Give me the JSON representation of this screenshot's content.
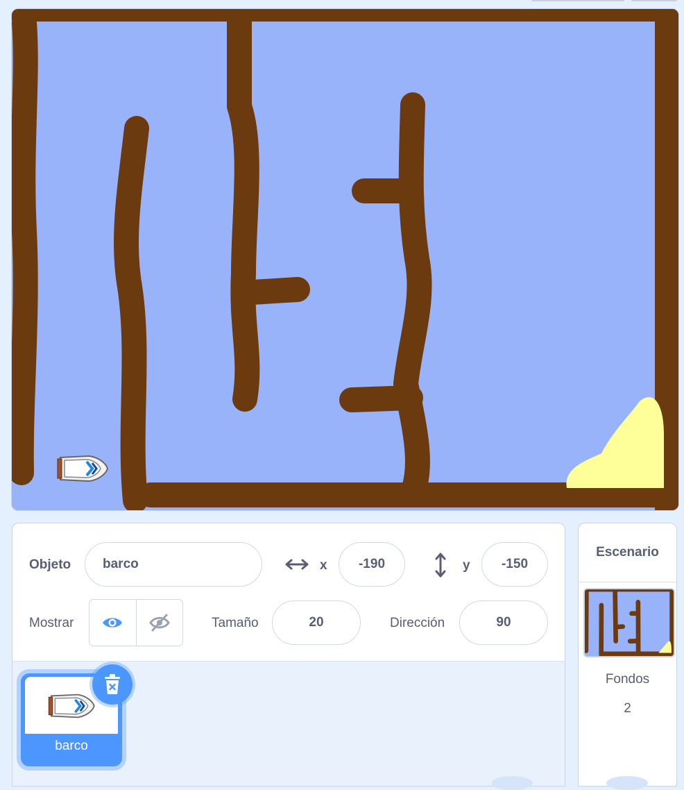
{
  "sprite_info": {
    "sprite_label": "Objeto",
    "sprite_name": "barco",
    "x_label": "x",
    "x_value": "-190",
    "y_label": "y",
    "y_value": "-150",
    "show_label": "Mostrar",
    "size_label": "Tamaño",
    "size_value": "20",
    "direction_label": "Dirección",
    "direction_value": "90"
  },
  "sprites": [
    {
      "name": "barco",
      "selected": true
    }
  ],
  "stage_panel": {
    "title": "Escenario",
    "backdrops_label": "Fondos",
    "backdrops_count": "2"
  },
  "colors": {
    "water": "#99b3fb",
    "wall": "#6b3a0f",
    "sand": "#ffff99",
    "accent": "#4c97ff"
  },
  "icons": [
    "x-arrows-icon",
    "y-arrows-icon",
    "eye-icon",
    "eye-hidden-icon",
    "trash-icon",
    "boat-icon"
  ]
}
